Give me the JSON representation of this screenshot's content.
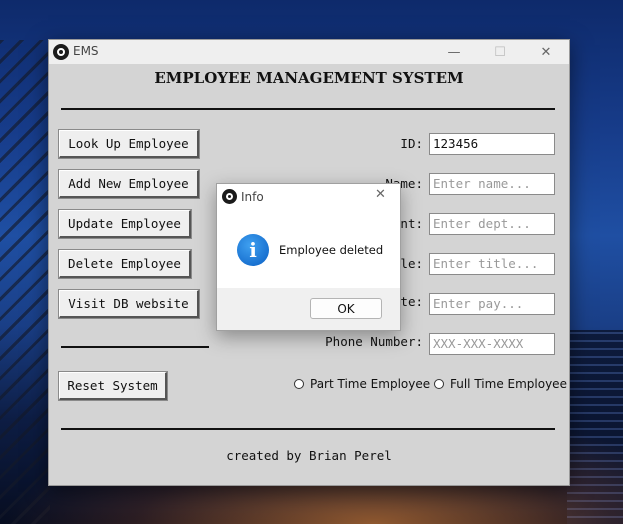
{
  "window": {
    "title": "EMS",
    "minimize_glyph": "—",
    "maximize_glyph": "☐",
    "close_glyph": "✕"
  },
  "heading": "EMPLOYEE MANAGEMENT SYSTEM",
  "buttons": {
    "lookup": "Look Up Employee",
    "add": "Add New Employee",
    "update": "Update Employee",
    "delete": "Delete Employee",
    "visit": "Visit DB website",
    "reset": "Reset System"
  },
  "form": {
    "id_label": "ID:",
    "id_value": "123456",
    "name_label": "Name:",
    "name_placeholder": "Enter name...",
    "dept_label": "ent:",
    "dept_placeholder": "Enter dept...",
    "title_label": "le:",
    "title_placeholder": "Enter title...",
    "pay_label": "te:",
    "pay_placeholder": "Enter pay...",
    "phone_label": "Phone Number:",
    "phone_placeholder": "XXX-XXX-XXXX"
  },
  "employment_type": {
    "part_time": "Part Time Employee",
    "full_time": "Full Time Employee"
  },
  "credit": "created by Brian Perel",
  "dialog": {
    "title": "Info",
    "close_glyph": "✕",
    "icon_glyph": "i",
    "message": "Employee deleted",
    "ok_label": "OK"
  }
}
